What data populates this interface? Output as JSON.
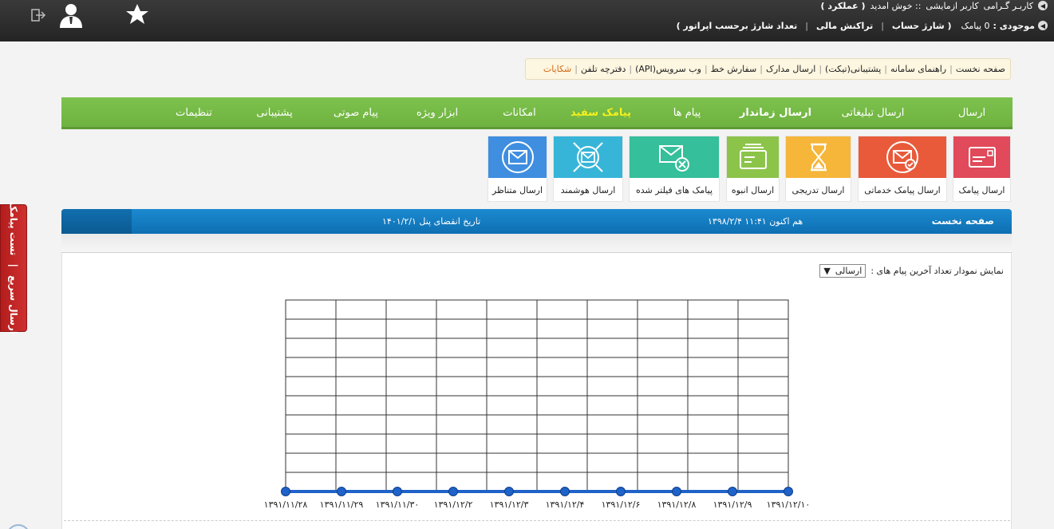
{
  "header": {
    "greeting_prefix": "کاربـر گـرامی",
    "user_name": "کاربر ازمایشی",
    "welcome": ":: خوش امدید",
    "performance_link": "( عملکرد )",
    "balance_label": "موجودی :",
    "balance_value": "0 پیامک",
    "charge_account": "( شارژ حساب",
    "financial_transactions": "تراکنش مالی",
    "charge_by_operator": "تعداد شارژ برحسب اپراتور )"
  },
  "quicknav": {
    "items": [
      {
        "label": "صفحه نخست"
      },
      {
        "label": "راهنمای سامانه"
      },
      {
        "label": "پشتیبانی(تیکت)"
      },
      {
        "label": "ارسال مدارک"
      },
      {
        "label": "سفارش خط"
      },
      {
        "label": "وب سرویس(API)"
      },
      {
        "label": "دفترچه تلفن"
      },
      {
        "label": "شکایات"
      }
    ]
  },
  "mainmenu": {
    "items": [
      {
        "label": "ارسال"
      },
      {
        "label": "ارسال تبلیغاتی"
      },
      {
        "label": "ارسال زماندار"
      },
      {
        "label": "پیام ها"
      },
      {
        "label": "پیامک سفید"
      },
      {
        "label": "امکانات"
      },
      {
        "label": "ابزار ویژه"
      },
      {
        "label": "پیام صوتی"
      },
      {
        "label": "پشتیبانی"
      },
      {
        "label": "تنظیمات"
      }
    ]
  },
  "tiles": [
    {
      "label": "ارسال پیامک",
      "color": "#e04a5a",
      "icon": "sms-card-icon"
    },
    {
      "label": "ارسال پیامک خدماتی",
      "color": "#e85a3a",
      "icon": "envelope-check-icon"
    },
    {
      "label": "ارسال تدریجی",
      "color": "#f6b63a",
      "icon": "hourglass-icon"
    },
    {
      "label": "ارسال انبوه",
      "color": "#8cc44a",
      "icon": "stacked-mail-icon"
    },
    {
      "label": "پیامک های فیلتر شده",
      "color": "#35bf9a",
      "icon": "envelope-blocked-icon"
    },
    {
      "label": "ارسال هوشمند",
      "color": "#37b5d8",
      "icon": "smart-envelope-icon"
    },
    {
      "label": "ارسال متناظر",
      "color": "#3f8ee0",
      "icon": "envelope-circle-icon"
    }
  ],
  "sidetab": {
    "quick_send": "ارسال سریع",
    "separator": "|",
    "test_sms": "تست پیامک"
  },
  "statusbar": {
    "page_title": "صفحه نخست",
    "now_label": "هم اکنون ۱۱:۴۱ ۱۳۹۸/۲/۴",
    "expiry_label": "تاریخ انقضای پنل ۱۴۰۱/۲/۱"
  },
  "chart_controls": {
    "label": "نمایش نمودار تعداد آخرین پیام های :",
    "selected": "ارسالی",
    "arrow": "▼"
  },
  "chart_data": {
    "type": "line",
    "x": [
      "۱۳۹۱/۱۱/۲۸",
      "۱۳۹۱/۱۱/۲۹",
      "۱۳۹۱/۱۱/۳۰",
      "۱۳۹۱/۱۲/۲",
      "۱۳۹۱/۱۲/۳",
      "۱۳۹۱/۱۲/۴",
      "۱۳۹۱/۱۲/۶",
      "۱۳۹۱/۱۲/۸",
      "۱۳۹۱/۱۲/۹",
      "۱۳۹۱/۱۲/۱۰"
    ],
    "series": [
      {
        "values": [
          0,
          0,
          0,
          0,
          0,
          0,
          0,
          0,
          0,
          0
        ],
        "color": "#1f62c9"
      }
    ],
    "grid": true,
    "line_color": "#1f62c9",
    "grid_color": "#333333"
  }
}
